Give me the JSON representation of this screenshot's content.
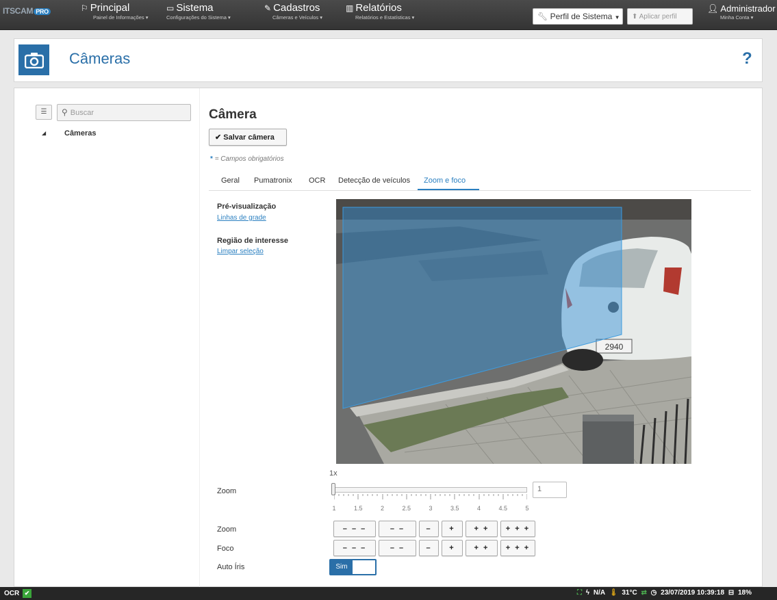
{
  "navbar": {
    "logo_text": "ITSCAM",
    "logo_badge": "PRO",
    "items": [
      {
        "label": "Principal",
        "sub": "Painel de Informações ▾",
        "icon": "flag-icon"
      },
      {
        "label": "Sistema",
        "sub": "Configurações do Sistema ▾",
        "icon": "monitor-icon"
      },
      {
        "label": "Cadastros",
        "sub": "Câmeras e Veículos ▾",
        "icon": "edit-icon"
      },
      {
        "label": "Relatórios",
        "sub": "Relatórios e Estatísticas ▾",
        "icon": "bar-chart-icon"
      }
    ],
    "profile_select": "Perfil de Sistema",
    "apply_button": "Aplicar perfil",
    "account_name": "Administrador",
    "account_sub": "Minha Conta ▾"
  },
  "header": {
    "title": "Câmeras",
    "help": "?"
  },
  "sidebar": {
    "search_placeholder": "Buscar",
    "tree_root": "Câmeras"
  },
  "main": {
    "title": "Câmera",
    "save_label": "Salvar câmera",
    "required_star": "*",
    "required_note": "= Campos obrigatórios",
    "tabs": [
      {
        "label": "Geral",
        "active": false
      },
      {
        "label": "Pumatronix",
        "active": false
      },
      {
        "label": "OCR",
        "active": false
      },
      {
        "label": "Detecção de veículos",
        "active": false
      },
      {
        "label": "Zoom e foco",
        "active": true
      }
    ],
    "preview_label": "Pré-visualização",
    "grid_link": "Linhas de grade",
    "roi_label": "Região de interesse",
    "clear_link": "Limpar seleção",
    "plate_text": "2940",
    "zoom_display": "1x",
    "zoom_label": "Zoom",
    "zoom_value": 1,
    "zoom_input": "1",
    "zoom_ticks": [
      "1",
      "1.5",
      "2",
      "2.5",
      "3",
      "3.5",
      "4",
      "4.5",
      "5"
    ],
    "zoom_row_label": "Zoom",
    "focus_row_label": "Foco",
    "step_buttons": [
      "– – –",
      "– –",
      "–",
      "+",
      "+ +",
      "+ + +"
    ],
    "auto_iris_label": "Auto Íris",
    "auto_iris_value": "Sim"
  },
  "statusbar": {
    "left_label": "OCR",
    "na": "N/A",
    "temp": "31°C",
    "datetime": "23/07/2019 10:39:18",
    "disk": "18%"
  }
}
